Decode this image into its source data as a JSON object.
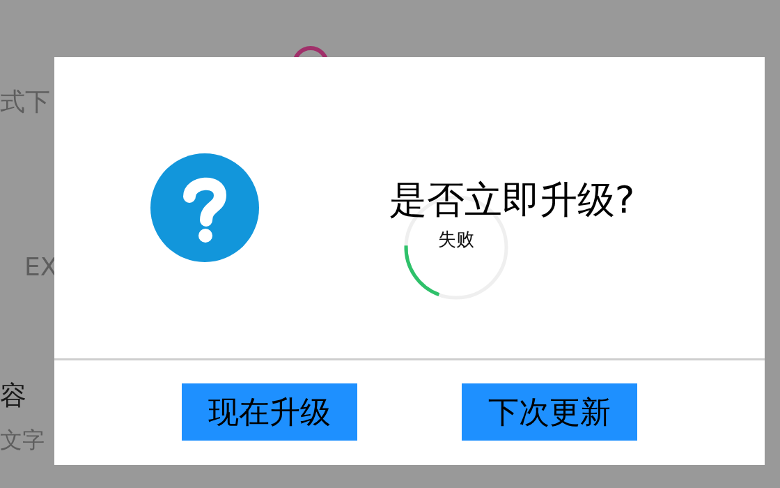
{
  "background": {
    "texts": [
      {
        "text": "式下",
        "kind": "body"
      },
      {
        "text": "EX",
        "kind": "body"
      },
      {
        "text": "容",
        "kind": "heading"
      },
      {
        "text": "文字",
        "kind": "caption"
      }
    ]
  },
  "dialog": {
    "title": "是否立即升级?",
    "progress": {
      "label": "失败",
      "level": 0.2
    },
    "buttons": [
      {
        "label": "现在升级"
      },
      {
        "label": "下次更新"
      }
    ]
  }
}
